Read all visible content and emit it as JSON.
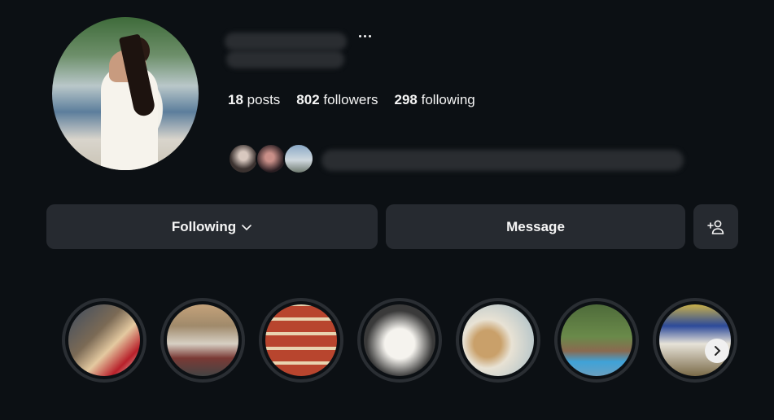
{
  "profile": {
    "more_icon": "ellipsis-icon",
    "stats": {
      "posts_count": "18",
      "posts_label": "posts",
      "followers_count": "802",
      "followers_label": "followers",
      "following_count": "298",
      "following_label": "following"
    }
  },
  "actions": {
    "following_label": "Following",
    "following_icon": "chevron-down-icon",
    "message_label": "Message",
    "add_user_icon": "add-user-icon"
  },
  "highlights": {
    "next_icon": "chevron-right-icon",
    "colors": [
      "#7b6a55",
      "#a08a6b",
      "#b8452e",
      "#3a3a3a",
      "#c9a06a",
      "#4e6b3a",
      "#c8b04a"
    ]
  },
  "colors": {
    "background": "#0c1014",
    "button_bg": "#262a30",
    "text": "#f5f5f5"
  }
}
